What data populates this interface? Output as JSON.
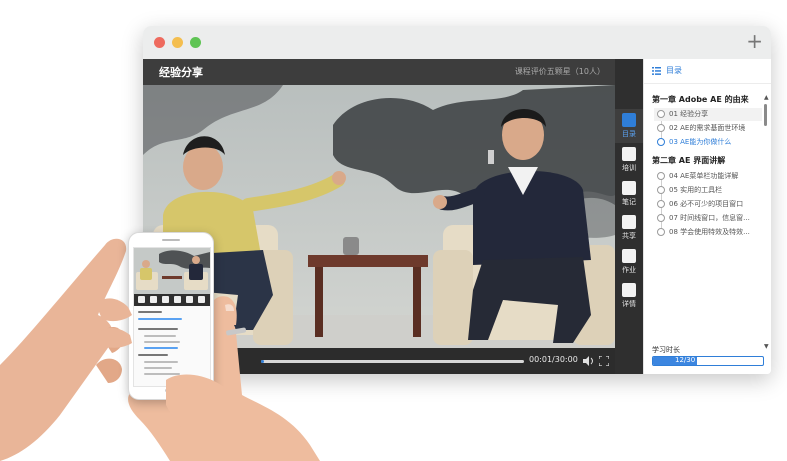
{
  "window": {
    "new_tab_symbol": "+"
  },
  "player": {
    "course_title": "经验分享",
    "rating_text": "课程评价五颗星（10人）",
    "time_display": "00:01/30:00",
    "progress": 0.01
  },
  "iconbar": {
    "items": [
      {
        "label": "目录",
        "icon": "list-icon",
        "active": true
      },
      {
        "label": "培训",
        "icon": "graduation-cap-icon",
        "active": false
      },
      {
        "label": "笔记",
        "icon": "notebook-icon",
        "active": false
      },
      {
        "label": "共享",
        "icon": "monitor-icon",
        "active": false
      },
      {
        "label": "作业",
        "icon": "pencil-icon",
        "active": false
      },
      {
        "label": "详情",
        "icon": "info-icon",
        "active": false
      }
    ]
  },
  "sidebar": {
    "header": "目录",
    "chapters": [
      {
        "title": "第一章 Adobe AE 的由来",
        "lessons": [
          "01 经验分享",
          "02 AE的需求基面世环境",
          "03 AE能为你做什么"
        ]
      },
      {
        "title": "第二章 AE 界面讲解",
        "lessons": [
          "04 AE菜单栏功能详解",
          "05 实用的工具栏",
          "06 必不可少的项目窗口",
          "07 时间线窗口，信息窗...",
          "08 学会使用特效及特效..."
        ]
      }
    ],
    "current_lesson": "01 经验分享",
    "active_lesson": "03 AE能为你做什么",
    "study_label": "学习时长",
    "study_value": "12/30",
    "study_progress": 0.4
  },
  "colors": {
    "accent": "#2f7ed8",
    "player_header": "#3d3d3d",
    "control_bar": "#2c2c2c",
    "icon_bar": "#2f2f2f"
  }
}
